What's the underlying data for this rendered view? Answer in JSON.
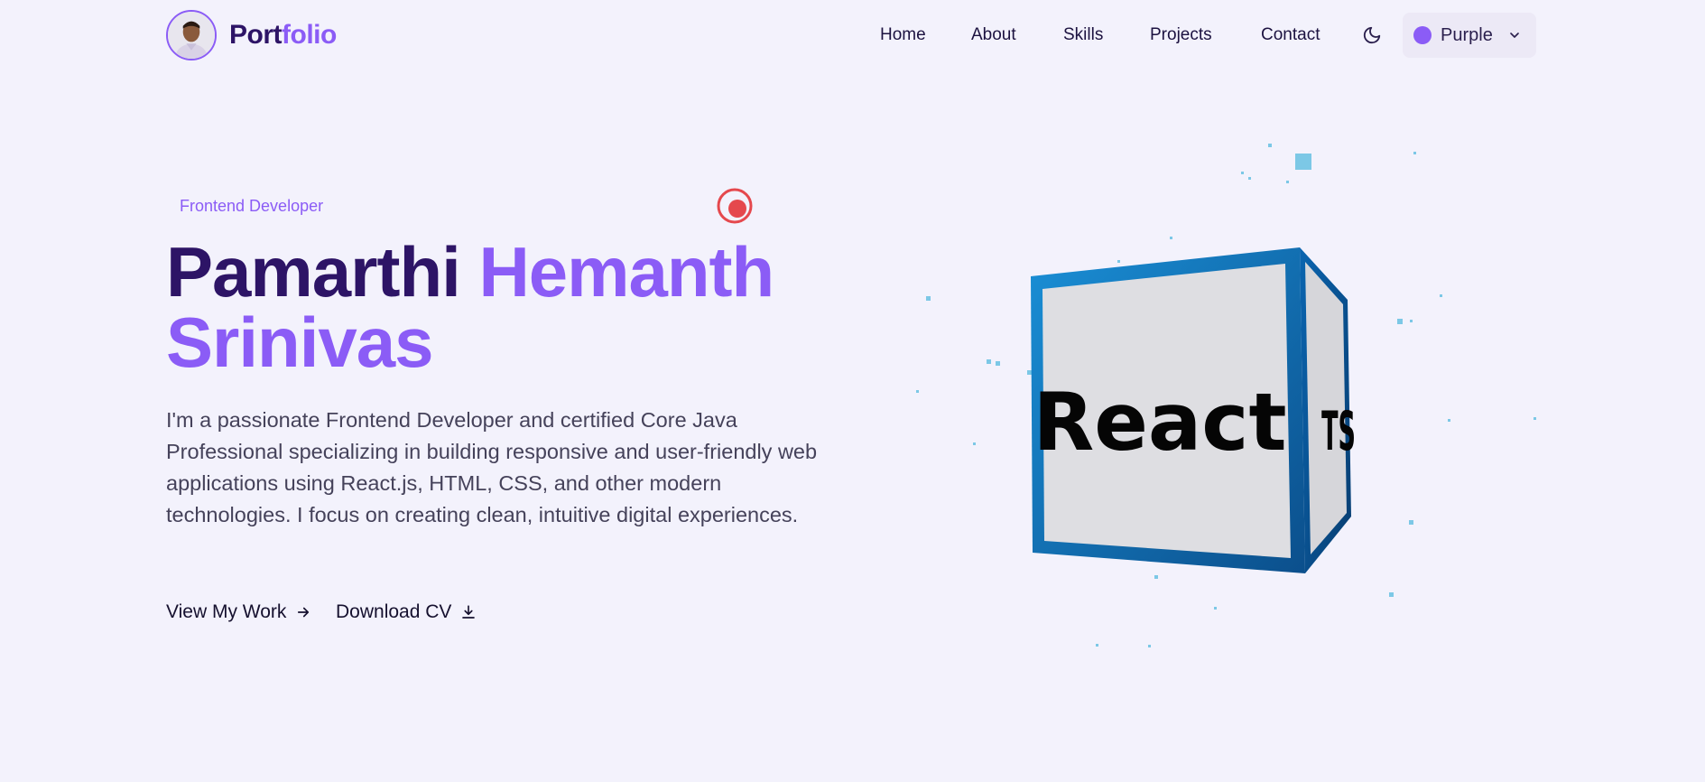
{
  "header": {
    "brand_first": "Port",
    "brand_second": "folio",
    "nav": [
      "Home",
      "About",
      "Skills",
      "Projects",
      "Contact"
    ],
    "theme_icon": "moon-icon",
    "color_select": {
      "value": "Purple",
      "swatch": "#8b5cf6"
    }
  },
  "hero": {
    "role": "Frontend Developer",
    "name_first": "Pamarthi",
    "name_rest": "Hemanth Srinivas",
    "bio": "I'm a passionate Frontend Developer and certified Core Java Professional specializing in building responsive and user-friendly web applications using React.js, HTML, CSS, and other modern technologies. I focus on creating clean, intuitive digital experiences.",
    "cta_primary": "View My Work",
    "cta_secondary": "Download CV"
  },
  "cube": {
    "front_label": "React",
    "side_label": "TS"
  },
  "colors": {
    "accent": "#8b5cf6",
    "dark": "#2d1466",
    "background": "#f3f2fc",
    "cube_blue": "#0b5aa0",
    "status_red": "#e5484d"
  }
}
